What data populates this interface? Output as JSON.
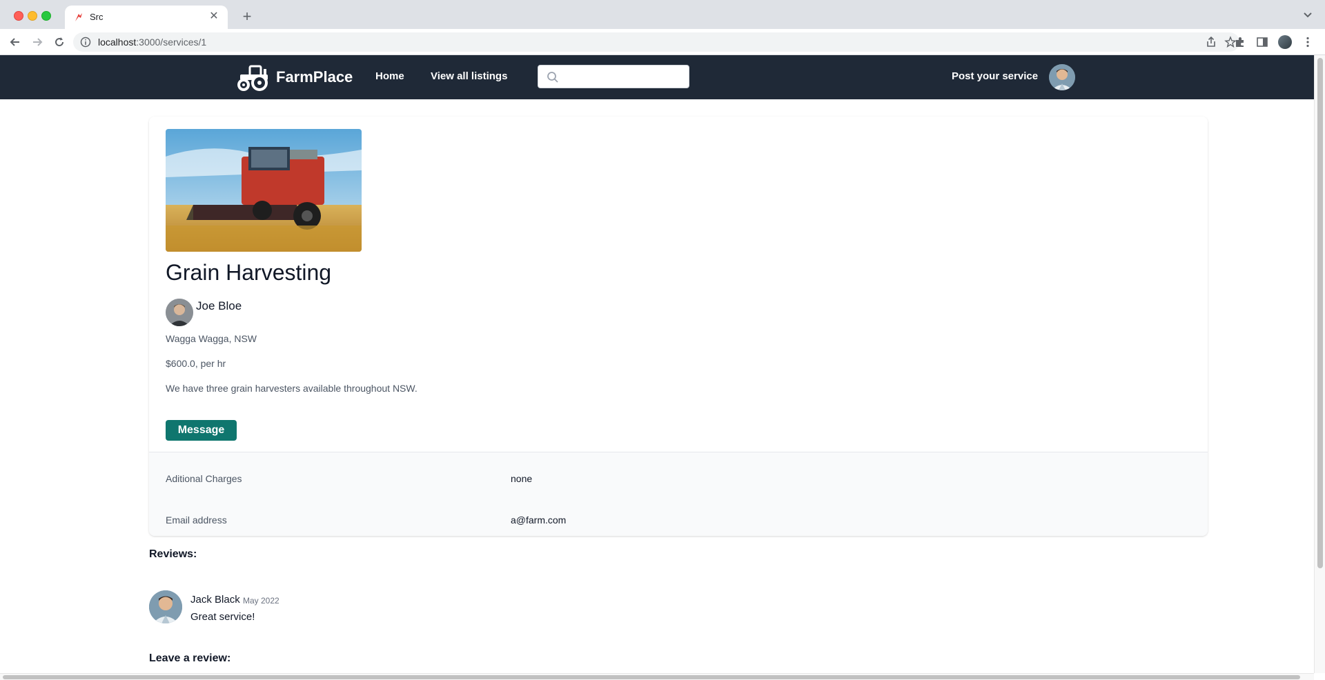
{
  "browser": {
    "tab_title": "Src",
    "url_host": "localhost",
    "url_path": ":3000/services/1"
  },
  "nav": {
    "brand": "FarmPlace",
    "home": "Home",
    "all_listings": "View all listings",
    "search_placeholder": "",
    "post_service": "Post your service"
  },
  "service": {
    "title": "Grain Harvesting",
    "provider": "Joe Bloe",
    "location": "Wagga Wagga, NSW",
    "price": "$600.0, per hr",
    "description": "We have three grain harvesters available throughout NSW.",
    "message_label": "Message",
    "details": [
      {
        "label": "Aditional Charges",
        "value": "none"
      },
      {
        "label": "Email address",
        "value": "a@farm.com"
      }
    ]
  },
  "reviews": {
    "heading": "Reviews:",
    "items": [
      {
        "name": "Jack Black",
        "date": "May 2022",
        "text": "Great service!"
      }
    ],
    "leave_heading": "Leave a review:"
  }
}
